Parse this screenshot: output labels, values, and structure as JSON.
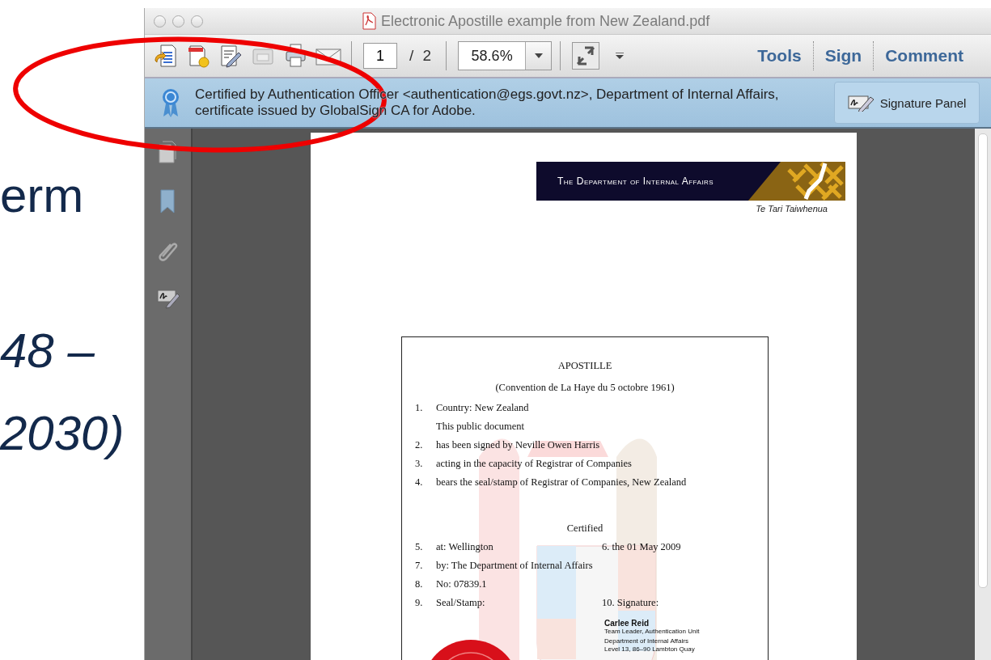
{
  "slide": {
    "lines": [
      {
        "text": "erm",
        "italic": false
      },
      {
        "text": "48 –",
        "italic": true
      },
      {
        "text": "2030)",
        "italic": true
      }
    ]
  },
  "window": {
    "title": "Electronic Apostille example from New Zealand.pdf",
    "toolbar": {
      "page_number": "1",
      "page_total": "/ 2",
      "zoom": "58.6%",
      "links": [
        "Tools",
        "Sign",
        "Comment"
      ]
    },
    "signature_bar": {
      "message": "Certified by Authentication Officer <authentication@egs.govt.nz>, Department of Internal Affairs, certificate issued by GlobalSign CA for Adobe.",
      "button": "Signature Panel"
    }
  },
  "document": {
    "header": "The Department of Internal Affairs",
    "subheader": "Te Tari Taiwhenua",
    "apostille": {
      "title": "APOSTILLE",
      "subtitle": "(Convention de La Haye du 5 octobre 1961)",
      "rows": [
        {
          "kind": "item",
          "number": "1.",
          "text": "Country: New Zealand"
        },
        {
          "kind": "plain",
          "text": "This public document"
        },
        {
          "kind": "item",
          "number": "2.",
          "text": "has been signed by Neville Owen Harris"
        },
        {
          "kind": "item",
          "number": "3.",
          "text": "acting in the capacity of Registrar of Companies"
        },
        {
          "kind": "item",
          "number": "4.",
          "text": "bears the seal/stamp of Registrar of Companies, New Zealand"
        },
        {
          "kind": "heading",
          "text": "Certified"
        },
        {
          "kind": "item",
          "number": "5.",
          "text": "at: Wellington",
          "right": "6. the 01 May 2009"
        },
        {
          "kind": "item",
          "number": "7.",
          "text": "by: The Department of Internal Affairs"
        },
        {
          "kind": "item",
          "number": "8.",
          "text": "No: 07839.1"
        },
        {
          "kind": "item",
          "number": "9.",
          "text": "Seal/Stamp:",
          "right": "10. Signature:"
        }
      ],
      "signer": {
        "name": "Carlee Reid",
        "role": "Team Leader, Authentication Unit",
        "lines": [
          "Department of Internal Affairs",
          "Level 13, 86–90 Lambton Quay"
        ]
      }
    }
  }
}
